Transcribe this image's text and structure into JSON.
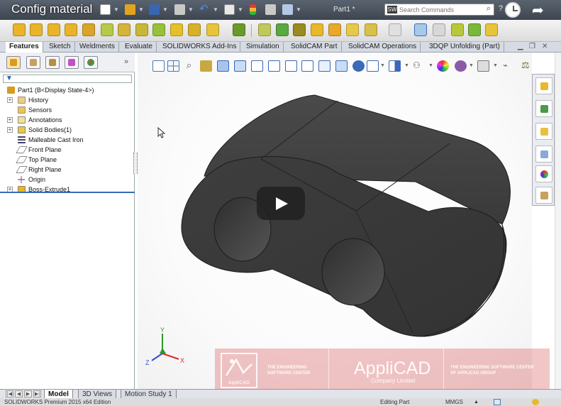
{
  "video": {
    "title": "Config material"
  },
  "window": {
    "document_title": "Part1 *",
    "search_placeholder": "Search Commands",
    "search_logo": "SW"
  },
  "tabs": [
    {
      "label": "Features"
    },
    {
      "label": "Sketch"
    },
    {
      "label": "Weldments"
    },
    {
      "label": "Evaluate"
    },
    {
      "label": "SOLIDWORKS Add-Ins"
    },
    {
      "label": "Simulation"
    },
    {
      "label": "SolidCAM Part"
    },
    {
      "label": "SolidCAM Operations"
    },
    {
      "label": "3DQP Unfolding (Part)"
    }
  ],
  "feature_tree": {
    "root": "Part1  (B<Display State-4>)",
    "items": [
      {
        "label": "History"
      },
      {
        "label": "Sensors"
      },
      {
        "label": "Annotations"
      },
      {
        "label": "Solid Bodies(1)"
      },
      {
        "label": "Malleable Cast Iron"
      },
      {
        "label": "Front Plane"
      },
      {
        "label": "Top Plane"
      },
      {
        "label": "Right Plane"
      },
      {
        "label": "Origin"
      },
      {
        "label": "Boss-Extrude1"
      }
    ]
  },
  "bottom_tabs": [
    {
      "label": "Model"
    },
    {
      "label": "3D Views"
    },
    {
      "label": "Motion Study 1"
    }
  ],
  "status_bar": {
    "edition": "SOLIDWORKS Premium 2015 x64 Edition",
    "mode": "Editing Part",
    "units": "MMGS"
  },
  "triad": {
    "x": "X",
    "y": "Y",
    "z": "Z"
  },
  "watermark": {
    "logo_text": "AppliCAD",
    "tagline_line1": "THE ENGINEERING",
    "tagline_line2": "SOFTWARE CENTER",
    "brand": "AppliCAD",
    "company": "Company Limited",
    "right_line1": "THE ENGINEERING SOFTWARE CENTER",
    "right_line2": "OF APPLICAD GROUP"
  },
  "colors": {
    "part_body": "#3d3d3d",
    "selection_blue": "#3a6ab8",
    "watermark_red": "#d64e4e"
  }
}
